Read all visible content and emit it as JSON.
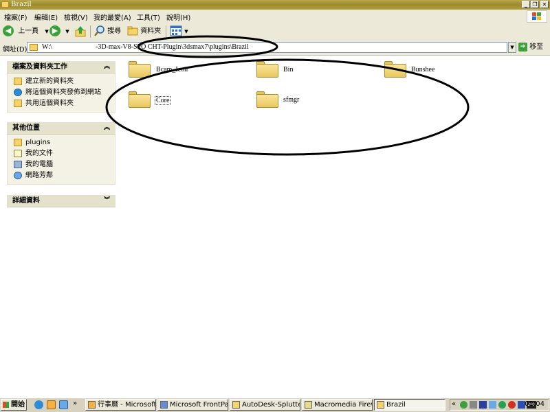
{
  "window": {
    "title": "Brazil"
  },
  "menu": [
    "檔案(F)",
    "編輯(E)",
    "檢視(V)",
    "我的最愛(A)",
    "工具(T)",
    "說明(H)"
  ],
  "toolbar": {
    "back": "上一頁",
    "search": "搜尋",
    "folders": "資料夾"
  },
  "address": {
    "label": "網址(D)",
    "prefix": "W:\\",
    "path": "-3D-max-V8-SPO CHT-Plugin\\3dsmax7\\plugins\\Brazil",
    "go": "移至"
  },
  "tasks": {
    "folder_tasks": {
      "title": "檔案及資料夾工作",
      "items": [
        "建立新的資料夾",
        "將這個資料夾發佈到網站",
        "共用這個資料夾"
      ]
    },
    "other_places": {
      "title": "其他位置",
      "items": [
        "plugins",
        "我的文件",
        "我的電腦",
        "網路芳鄰"
      ]
    },
    "details": {
      "title": "詳細資料"
    }
  },
  "folders": [
    "Bcam_Icon",
    "Bin",
    "Bunshee",
    "Core",
    "sfmgr"
  ],
  "taskbar": {
    "start": "開始",
    "buttons": [
      "行事曆 - Microsoft ...",
      "Microsoft FrontPage...",
      "AutoDesk-Splutterfi...",
      "Macromedia Firewo...",
      "Brazil"
    ],
    "tray_number": "281",
    "clock": "01:04"
  },
  "annotation": {
    "color": "#000000"
  }
}
